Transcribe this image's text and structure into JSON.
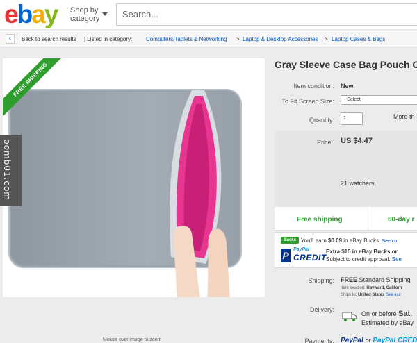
{
  "header": {
    "logo": [
      "e",
      "b",
      "a",
      "y"
    ],
    "shop_by": "Shop by\ncategory",
    "search_placeholder": "Search..."
  },
  "breadcrumb": {
    "back": "Back to search results",
    "listed": "| Listed in category:",
    "path": [
      "Computers/Tablets & Networking",
      "Laptop & Desktop Accessories",
      "Laptop Cases & Bags"
    ],
    "separator": ">"
  },
  "image_panel": {
    "ribbon": "FREE SHIPPING",
    "zoom_note": "Mouse over image to zoom"
  },
  "watermark": "bomb01.com",
  "listing": {
    "title": "Gray Sleeve Case Bag Pouch Co",
    "condition_label": "Item condition:",
    "condition": "New",
    "screen_size_label": "To Fit Screen Size:",
    "screen_size_value": "- Select -",
    "quantity_label": "Quantity:",
    "quantity_value": "1",
    "more": "More th",
    "price_label": "Price:",
    "price": "US $4.47",
    "watchers": "21 watchers",
    "free_shipping": "Free shipping",
    "returns": "60-day r"
  },
  "bucks": {
    "badge": "Bucks",
    "text_prefix": "You'll earn ",
    "amount": "$0.09",
    "text_suffix": " in eBay Bucks.",
    "see": "See co"
  },
  "paypal_credit": {
    "paypal": "PayPal",
    "credit": "CREDIT",
    "line1": "Extra $15 in eBay Bucks on",
    "line2": "Subject to credit approval.",
    "see": "See"
  },
  "shipping": {
    "label": "Shipping:",
    "free": "FREE",
    "method": "Standard Shipping",
    "location_label": "Item location:",
    "location": "Hayward, Californ",
    "ships_to_label": "Ships to:",
    "ships_to": "United States",
    "see_exclusions": "See exc"
  },
  "delivery": {
    "label": "Delivery:",
    "line1_prefix": "On or before ",
    "line1_day": "Sat.",
    "line2": "Estimated by eBay"
  },
  "payments": {
    "label": "Payments:",
    "paypal": "PayPal",
    "or": "or",
    "paypal_credit": "PayPal CREDIT"
  },
  "colors": {
    "ebay_red": "#e53238",
    "ebay_blue": "#0064d2",
    "ebay_yellow": "#f5af02",
    "ebay_green": "#86b817",
    "free_green": "#2a9d2a",
    "sleeve_pink": "#e8358f"
  }
}
